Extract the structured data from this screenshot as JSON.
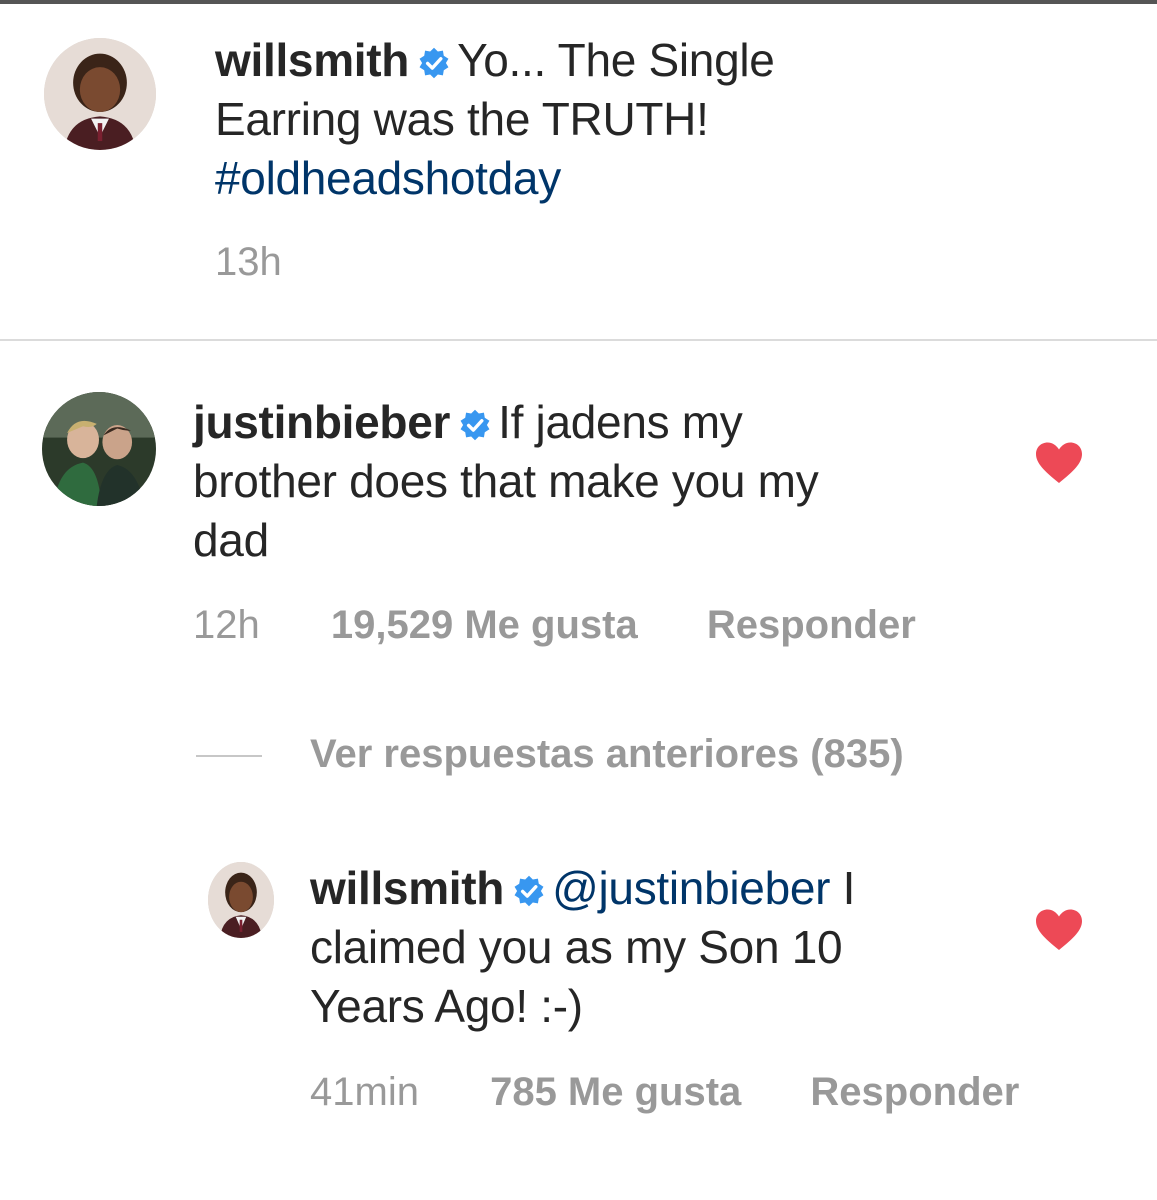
{
  "caption": {
    "username": "willsmith",
    "text": "Yo... The Single",
    "text_line2": "Earring was the TRUTH!",
    "hashtag": "#oldheadshotday",
    "time": "13h",
    "avatar_icon": "child-portrait-avatar",
    "verified_icon": "verified-badge-icon"
  },
  "comment": {
    "username": "justinbieber",
    "text_line1": "If jadens my",
    "text_line2": "brother does that make you my",
    "text_line3": "dad",
    "time": "12h",
    "likes": "19,529 Me gusta",
    "reply_label": "Responder",
    "liked": true
  },
  "view_replies": {
    "label": "Ver respuestas anteriores (835)"
  },
  "reply": {
    "username": "willsmith",
    "mention": "@justinbieber",
    "text_line1_tail": " I",
    "text_line2": "claimed you as my Son 10",
    "text_line3": "Years Ago! :-)",
    "time": "41min",
    "likes": "785 Me gusta",
    "reply_label": "Responder",
    "liked": true
  },
  "colors": {
    "text": "#262626",
    "link": "#003569",
    "meta": "#999999",
    "verified": "#3897f0",
    "heart": "#ed4956",
    "divider": "#dbdbdb"
  }
}
